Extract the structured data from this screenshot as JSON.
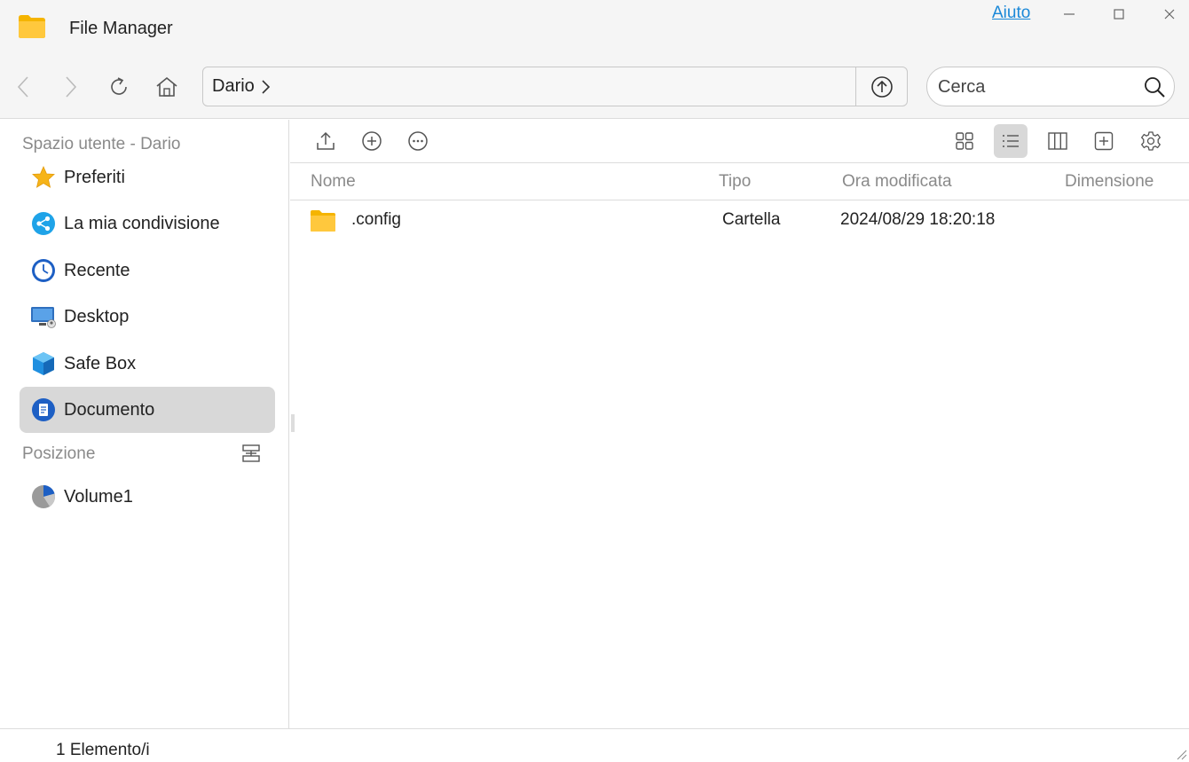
{
  "window": {
    "title": "File Manager",
    "help_link": "Aiuto"
  },
  "nav": {
    "path_segment": "Dario",
    "search_placeholder": "Cerca"
  },
  "sidebar": {
    "user_section_title": "Spazio utente - Dario",
    "items": [
      {
        "label": "Preferiti",
        "icon": "star-icon"
      },
      {
        "label": "La mia condivisione",
        "icon": "share-icon"
      },
      {
        "label": "Recente",
        "icon": "clock-icon"
      },
      {
        "label": "Desktop",
        "icon": "desktop-icon"
      },
      {
        "label": "Safe Box",
        "icon": "safe-box-icon"
      },
      {
        "label": "Documento",
        "icon": "document-icon",
        "active": true
      }
    ],
    "location_section_title": "Posizione",
    "locations": [
      {
        "label": "Volume1",
        "icon": "volume-icon"
      }
    ]
  },
  "table": {
    "columns": [
      "Nome",
      "Tipo",
      "Ora modificata",
      "Dimensione"
    ],
    "rows": [
      {
        "name": ".config",
        "type": "Cartella",
        "modified": "2024/08/29 18:20:18",
        "size": ""
      }
    ]
  },
  "status": {
    "count_text": "1 Elemento/i"
  },
  "colors": {
    "accent_link": "#1a88d8",
    "folder_yellow": "#ffc83d",
    "active_bg": "#d8d8d8"
  }
}
